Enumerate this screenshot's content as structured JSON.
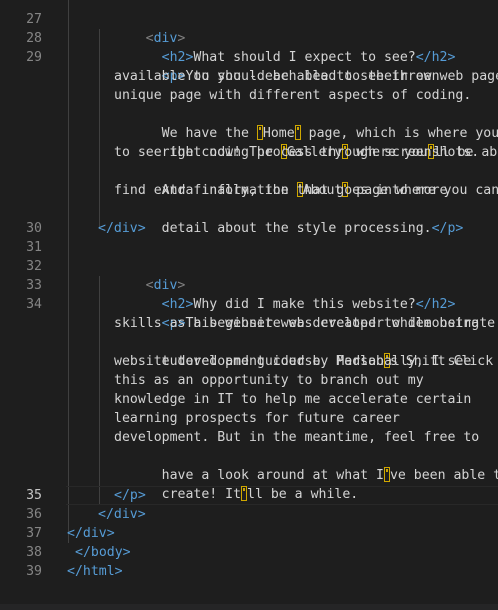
{
  "editor": {
    "line_numbers": [
      "27",
      "28",
      "29",
      "30",
      "31",
      "32",
      "33",
      "34",
      "35",
      "36",
      "37",
      "38",
      "39"
    ],
    "active_line": "35",
    "blocks": {
      "l27": {
        "open": "<",
        "name": "div",
        "close": ">"
      },
      "l28": {
        "h2_open": "<h2>",
        "text": "What should I expect to see?",
        "h2_close": "</h2>"
      },
      "l29": {
        "p_open": "<p>",
        "w1": "You should be able to see three web pages",
        "w2": "available to you - each lead to their own",
        "w3": "unique page with different aspects of coding.",
        "w4a": "We have the ",
        "w4b": "Home",
        "w4c": " page, which is where you are",
        "w5a": "right now! The ",
        "w5b": "Gallery",
        "w5c": " where you",
        "w5d": "ll be able",
        "w6": "to see the coding process through screenshots.",
        "w7a": "And finally, the ",
        "w7b": "About",
        "w7c": " page where you can",
        "w8": "find extra information that goes into more",
        "w9a": "detail about the style processing.",
        "p_close": "</p>"
      },
      "l30": "</div>",
      "l32": {
        "open": "<",
        "name": "div",
        "close": ">"
      },
      "l33": {
        "h2_open": "<h2>",
        "text": "Why did I make this website?",
        "h2_close": "</h2>"
      },
      "l34": {
        "p_open": "<p>",
        "w1": "This website was created to demonstrate my",
        "w2": "skills as a beginner web developer while being",
        "w3": "tutored and guided by Madlab",
        "w3b": "s Shift Click",
        "w4": "website development course. Personally, I see",
        "w5": "this as an opportunity to branch out my",
        "w6": "knowledge in IT to help me accelerate certain",
        "w7": "learning prospects for future career",
        "w8": "development. But in the meantime, feel free to",
        "w9": "have a look around at what I",
        "w9b": "ve been able to",
        "w10": "create! It",
        "w10b": "ll be a while."
      },
      "l35": "</p>",
      "l36": "</div>",
      "l37": "</div>",
      "l38": "</body>",
      "l39": "</html>"
    },
    "colors": {
      "background": "#1e1e1e",
      "tag": "#569cd6",
      "bracket": "#808080",
      "text": "#d4d4d4",
      "line_number": "#858585",
      "unicode_highlight": "#cfa700"
    }
  }
}
